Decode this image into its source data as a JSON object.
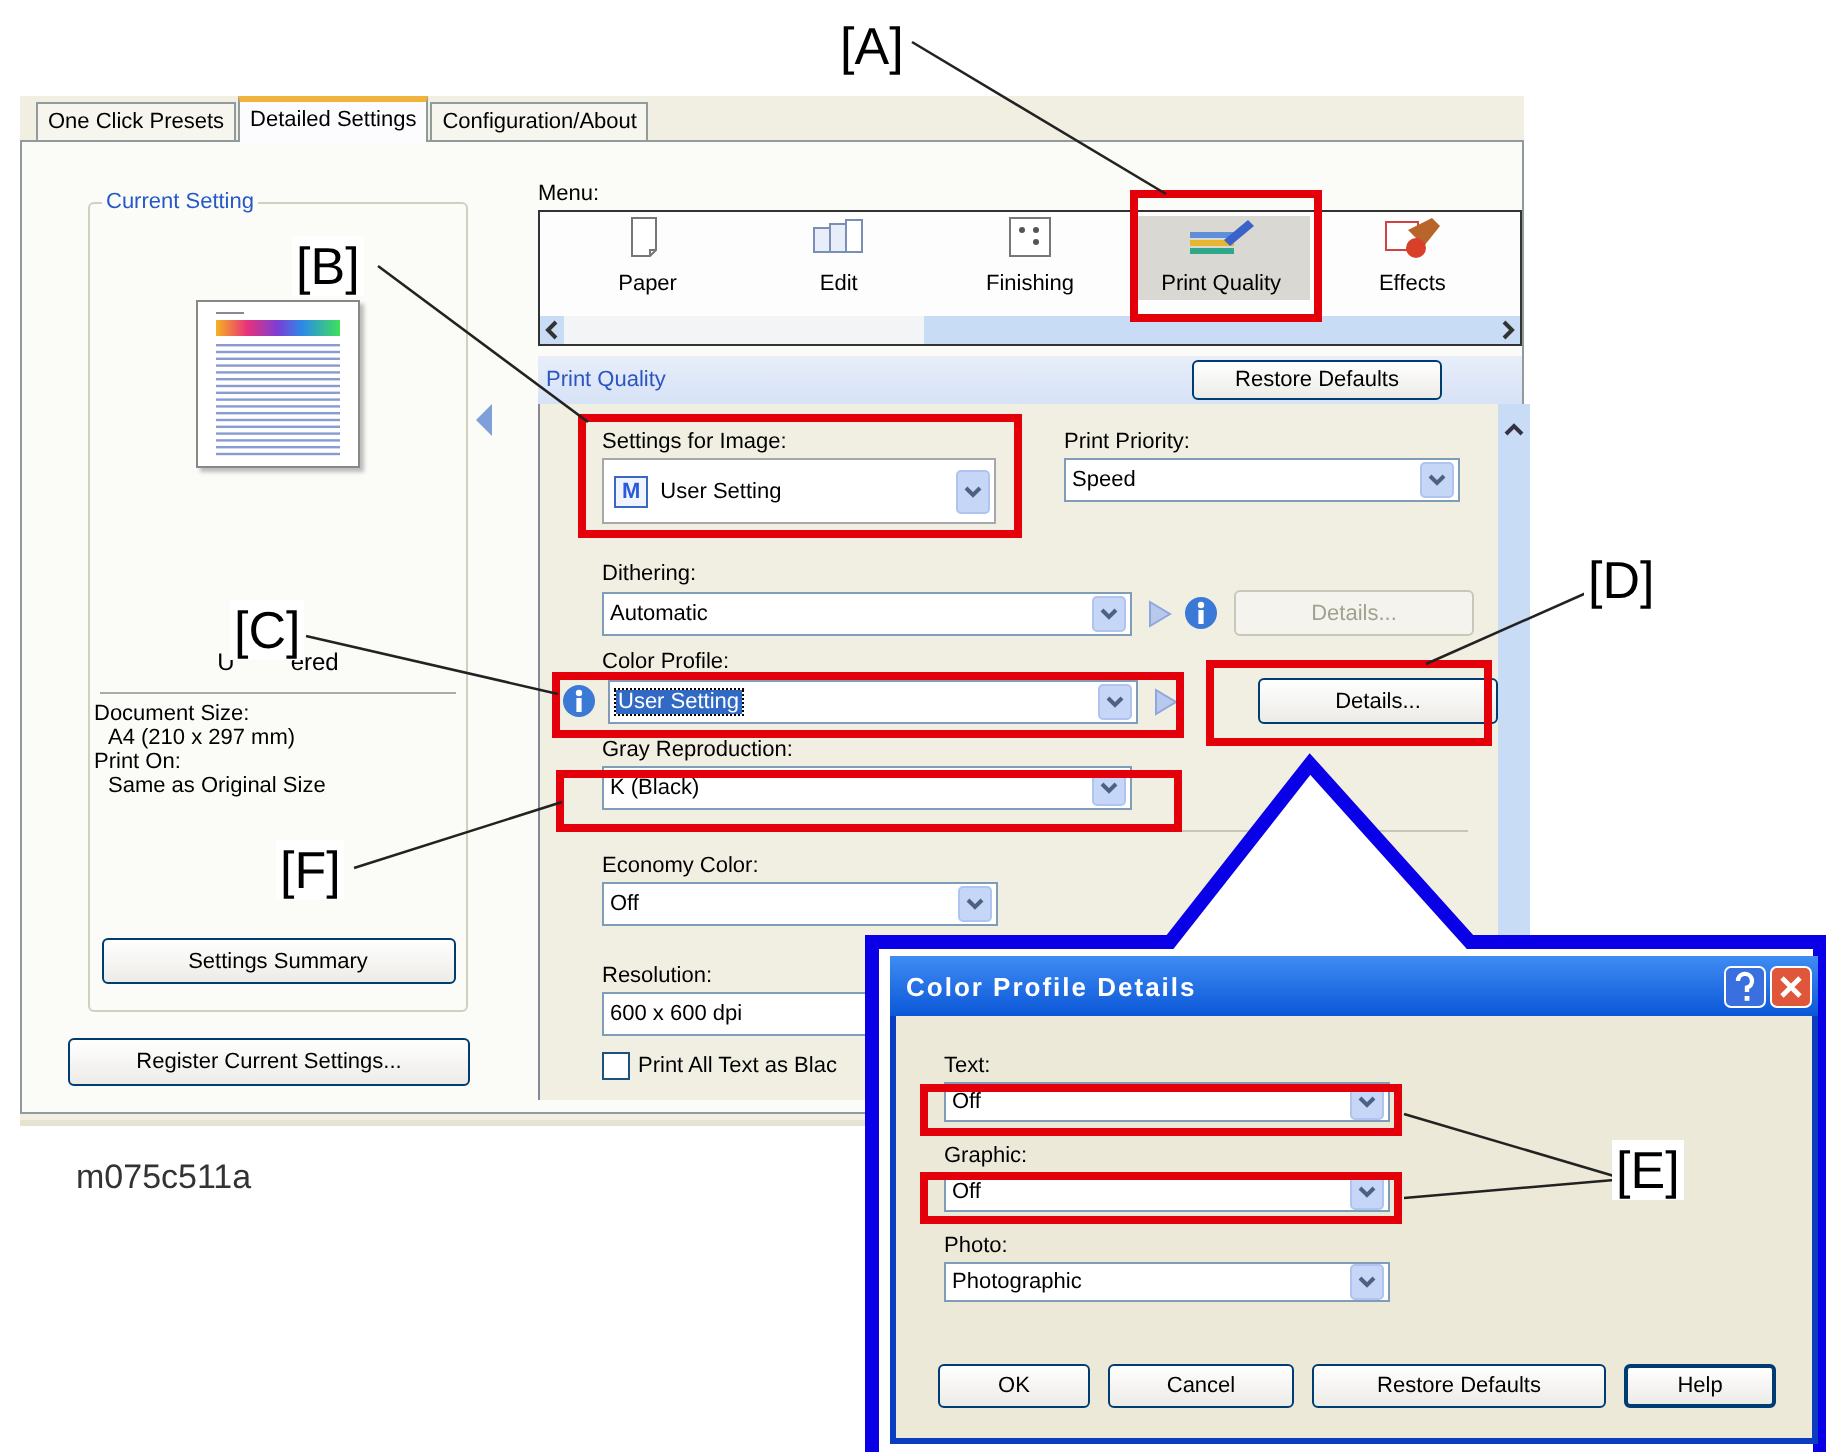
{
  "tabs": [
    {
      "label": "One Click Presets",
      "selected": false
    },
    {
      "label": "Detailed Settings",
      "selected": true
    },
    {
      "label": "Configuration/About",
      "selected": false
    }
  ],
  "current_setting": {
    "title": "Current Setting",
    "caption_start": "U",
    "caption_end": "ered",
    "info": [
      {
        "label": "Document Size:",
        "value": "A4 (210 x 297 mm)"
      },
      {
        "label": "Print On:",
        "value": "Same as Original Size"
      }
    ],
    "summary_button": "Settings Summary"
  },
  "register_button": "Register Current Settings...",
  "menu": {
    "label": "Menu:",
    "items": [
      {
        "label": "Paper",
        "selected": false
      },
      {
        "label": "Edit",
        "selected": false
      },
      {
        "label": "Finishing",
        "selected": false
      },
      {
        "label": "Print Quality",
        "selected": true
      },
      {
        "label": "Effects",
        "selected": false
      }
    ]
  },
  "section": {
    "title": "Print Quality",
    "restore_button": "Restore Defaults"
  },
  "settings_for_image": {
    "label": "Settings for Image:",
    "badge": "M",
    "value": "User Setting"
  },
  "print_priority": {
    "label": "Print Priority:",
    "value": "Speed"
  },
  "dithering": {
    "label": "Dithering:",
    "value": "Automatic",
    "details_button": {
      "label": "Details...",
      "disabled": true
    }
  },
  "color_profile": {
    "label": "Color Profile:",
    "value": "User Setting",
    "highlighted": true,
    "details_button": {
      "label": "Details...",
      "disabled": false
    }
  },
  "gray_reproduction": {
    "label": "Gray Reproduction:",
    "value": "K (Black)"
  },
  "economy_color": {
    "label": "Economy Color:",
    "value": "Off"
  },
  "resolution": {
    "label": "Resolution:",
    "value": "600 x 600 dpi"
  },
  "print_all_text_black": {
    "label": "Print All Text as Blac",
    "checked": false
  },
  "popup": {
    "title": "Color Profile Details",
    "fields": [
      {
        "label": "Text:",
        "value": "Off"
      },
      {
        "label": "Graphic:",
        "value": "Off"
      },
      {
        "label": "Photo:",
        "value": "Photographic"
      }
    ],
    "buttons": [
      {
        "label": "OK"
      },
      {
        "label": "Cancel"
      },
      {
        "label": "Restore Defaults"
      },
      {
        "label": "Help"
      }
    ]
  },
  "callouts": [
    {
      "label": "[A]"
    },
    {
      "label": "[B]"
    },
    {
      "label": "[C]"
    },
    {
      "label": "[D]"
    },
    {
      "label": "[E]"
    },
    {
      "label": "[F]"
    }
  ],
  "figure_id": "m075c511a"
}
